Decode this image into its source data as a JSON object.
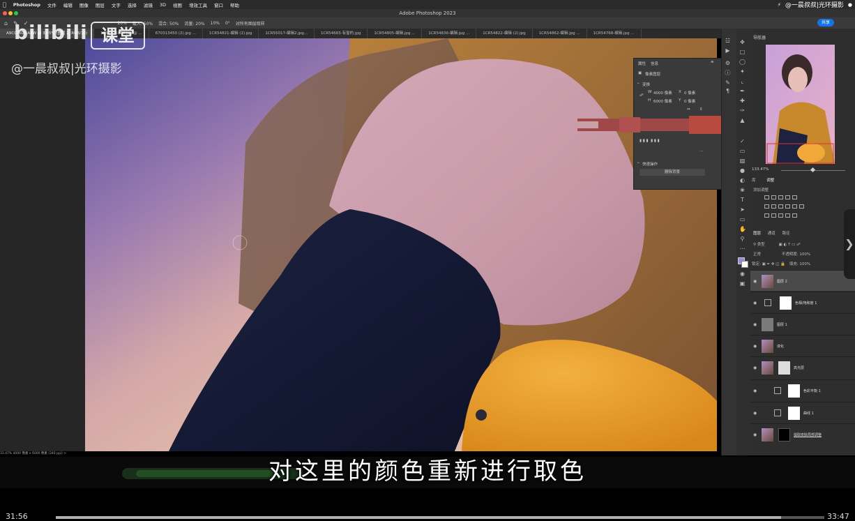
{
  "menubar": {
    "apple": "",
    "items": [
      "Photoshop",
      "文件",
      "编辑",
      "图像",
      "图层",
      "文字",
      "选择",
      "滤镜",
      "3D",
      "视图",
      "增效工具",
      "窗口",
      "帮助"
    ],
    "right_text": "@一晨叔叔|光环摄影"
  },
  "titlebar": {
    "title": "Adobe Photoshop 2023"
  },
  "optbar": {
    "items": [
      "20%",
      "载入: 50%",
      "混合: 50%",
      "流量: 20%",
      "10%",
      "0°",
      "对所有图层取样"
    ],
    "share_label": "共享"
  },
  "tabs": {
    "items": [
      "A9C07606.ARW @ 33.5% (图层 2, RGB/16)",
      "1253976974.jpg @ ...",
      "670313450 (2).jpg ...",
      "1CR54821-编辑 (2).jpg",
      "1CR55017-编辑2.jpg...",
      "1CR54683-有窗的.jpg",
      "1CR54805-编辑.jpg ...",
      "1CR54836-编辑.jpg ...",
      "1CR54822-编辑 (2).jpg",
      "1CR54862-编辑.jpg ...",
      "1CR54768-编辑.jpg ..."
    ]
  },
  "watermark": {
    "logo": "bilibili",
    "ketang": "课堂",
    "author": "@一晨叔叔|光环摄影"
  },
  "statusbar": {
    "text": "33.47%   4000 像素 x 6000 像素 (240 ppi)  >"
  },
  "properties": {
    "tab1": "属性",
    "tab2": "信息",
    "layer_type": "像素图层",
    "section_transform": "变换",
    "w_label": "W",
    "w_value": "4000 像素",
    "x_label": "X",
    "x_value": "0 像素",
    "h_label": "H",
    "h_value": "6000 像素",
    "y_label": "Y",
    "y_value": "0 像素",
    "section_quick": "快速操作",
    "remove_bg": "删除背景"
  },
  "navigator": {
    "title": "导航器",
    "zoom": "133.47%"
  },
  "adjustments": {
    "tab1": "库",
    "tab2": "调整",
    "add_label": "添加调整"
  },
  "layers": {
    "tab1": "图层",
    "tab2": "通道",
    "tab3": "路径",
    "filter": "类型",
    "blend": "正常",
    "opacity_label": "不透明度:",
    "opacity": "100%",
    "lock_label": "锁定:",
    "fill_label": "填充:",
    "fill": "100%",
    "items": [
      {
        "name": "图层 2"
      },
      {
        "name": "色相/饱和度 1"
      },
      {
        "name": "图层 1"
      },
      {
        "name": "液化"
      },
      {
        "name": "高光层"
      },
      {
        "name": "色彩平衡 1"
      },
      {
        "name": "曲线 1"
      },
      {
        "name": "提取皮肤局部调整"
      }
    ]
  },
  "subtitle": {
    "text": "对这里的颜色重新进行取色"
  },
  "player": {
    "current": "31:56",
    "total": "33:47",
    "progress": 0.944
  }
}
